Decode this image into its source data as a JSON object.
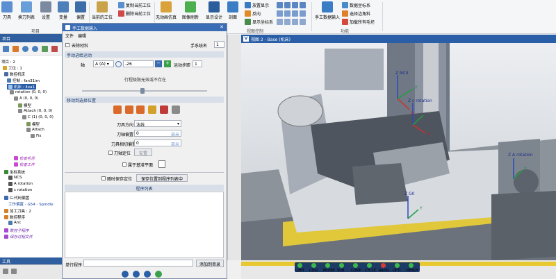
{
  "ribbon": {
    "tools": "刀具",
    "tool_list": "换刀列表",
    "settings": "设置",
    "variables": "变量",
    "offset": "偏置",
    "project_group": "项目",
    "current_station": "当前的工位",
    "copy_station": "复制当前工位",
    "delete_station": "删除当前工位",
    "no_anim": "无动画仿真",
    "image_refresh": "图像刷新",
    "display_design": "显示设计",
    "section": "剖面",
    "zoom_display": "放置显示",
    "reverse": "反向",
    "display_coord": "显示坐标系",
    "view_control_group": "视图控制",
    "manual_input": "手工数据输入",
    "data_coord": "数据坐标系",
    "select_edge": "选择边角料",
    "load_blank": "加载所有毛坯",
    "function_group": "功能"
  },
  "tree": {
    "header": "项目",
    "items": [
      "项目 : 2",
      "工位 : 1",
      "数控机床",
      "控制 : fan31im",
      "机床 : 4xa1",
      "rotation (0, 0, 0)",
      "A (0, 0, 0)",
      "模型",
      "Attach (0, 0, 0)",
      "C (1) (0, 0, 0)",
      "模型",
      "Attach",
      "Fix",
      "检查毛坯",
      "检查工件",
      "坐标系统",
      "NCS",
      "A rotation",
      "c rotation",
      "G-代码偏置",
      "工作偏置 - G54 - Spindle",
      "加工刀具 : 2",
      "数控程序",
      "Anc",
      "数控子程序",
      "保存过程文件"
    ],
    "bottom_label": "工具"
  },
  "dialog": {
    "title": "手工数据输入",
    "menu_file": "文件",
    "menu_edit": "编辑",
    "blank_check_label": "去除材料",
    "coord_label": "手系统名",
    "coord_value": "1",
    "sec_manual": "手动进给运动",
    "axis_label": "轴",
    "axis_value": "A (A)",
    "axis_input": "-26",
    "step_label": "运动步距",
    "step_value": "1",
    "limit_text": "行程极限无效或不存在",
    "sec_move": "移动到选择位置",
    "tool_dir_label": "刀具方向",
    "tool_dir_value": "法线",
    "tool_offset_label": "刀轴偏置",
    "tool_offset_value": "0",
    "tool_offset_unit": "毫米",
    "cut_offset_label": "刀具相切偏置",
    "cut_offset_value": "0",
    "cut_offset_unit": "毫米",
    "tool_pos_label": "刀轴定位",
    "tool_pos_btn": "安置",
    "ref_plane_label": "属于基准平面",
    "save_pos_label": "随时保存定位",
    "save_pos_btn": "保存位置到程序列表中",
    "program_list": "程序列表",
    "single_prog": "单行程序",
    "add_list_btn": "添加到目录"
  },
  "viewport": {
    "title": "视图 2 - Base (机床)",
    "labels": [
      "Z NCS",
      "Y",
      "Z c rotation",
      "X",
      "Z A rotation",
      "Y",
      "X",
      "Z  G0",
      "Y"
    ]
  },
  "status": {
    "leds": [
      "LIMIT",
      "COLL",
      "PROBE",
      "SUB",
      "COMP",
      "CYCLE",
      "RAPID",
      "OPTI",
      "READY"
    ],
    "colors": [
      "#3cb84a",
      "#3cb84a",
      "#3cb84a",
      "#3cb84a",
      "#3cb84a",
      "#3cb84a",
      "#d93a3a",
      "#3cb84a",
      "#3cb84a"
    ]
  },
  "colors": {
    "accent": "#2a5fa8",
    "yellow_table": "#d7c33b"
  }
}
